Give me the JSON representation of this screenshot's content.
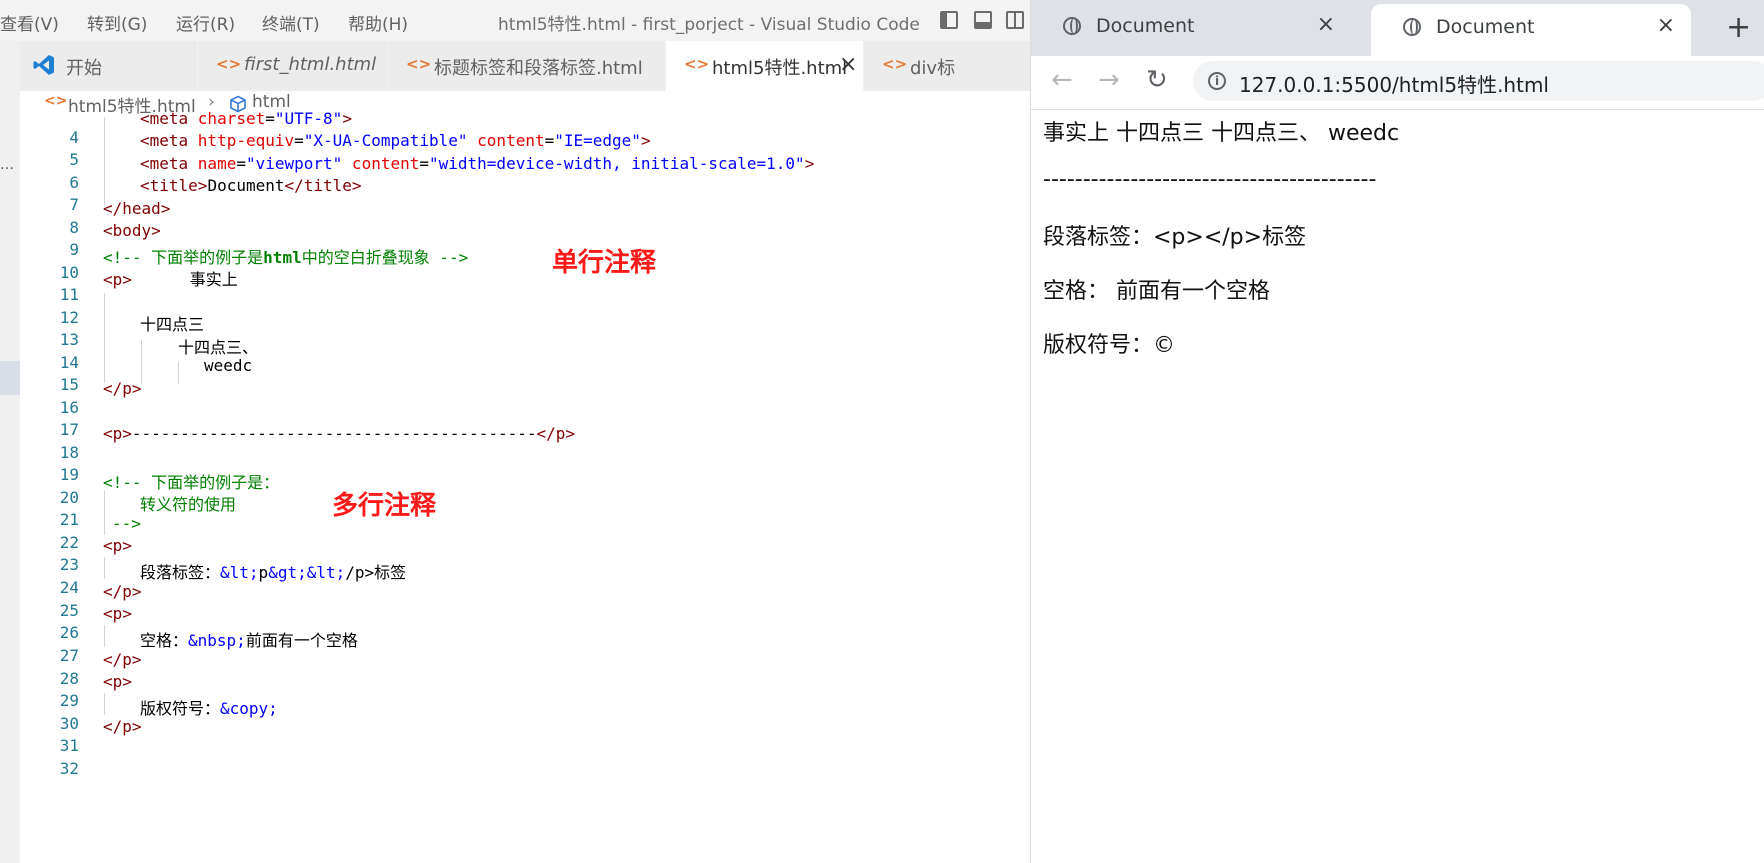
{
  "vscode": {
    "menu": [
      "查看(V)",
      "转到(G)",
      "运行(R)",
      "终端(T)",
      "帮助(H)"
    ],
    "window_title": "html5特性.html - first_porject - Visual Studio Code",
    "tabs": [
      {
        "label": "开始",
        "icon": "vscode-logo-icon"
      },
      {
        "label": "first_html.html",
        "icon": "html-file-icon"
      },
      {
        "label": "标题标签和段落标签.html",
        "icon": "html-file-icon"
      },
      {
        "label": "html5特性.html",
        "icon": "html-file-icon",
        "active": true,
        "close": "×"
      },
      {
        "label": "div标",
        "icon": "html-file-icon"
      }
    ],
    "breadcrumb": {
      "file": "html5特性.html",
      "separator": "›",
      "symbol": "html"
    },
    "activity_dots": "…",
    "line_numbers": [
      "4",
      "5",
      "6",
      "7",
      "8",
      "9",
      "10",
      "11",
      "12",
      "13",
      "14",
      "15",
      "16",
      "17",
      "18",
      "19",
      "20",
      "21",
      "22",
      "23",
      "24",
      "25",
      "26",
      "27",
      "28",
      "29",
      "30",
      "31",
      "32"
    ],
    "code": {
      "l4": {
        "open": "<meta ",
        "attr": "charset",
        "eq": "=",
        "val": "\"UTF-8\"",
        "close": ">"
      },
      "l5": {
        "open": "<meta ",
        "attr1": "http-equiv",
        "eq1": "=",
        "val1": "\"X-UA-Compatible\"",
        "attr2": " content",
        "eq2": "=",
        "val2": "\"IE=edge\"",
        "close": ">"
      },
      "l6": {
        "open": "<meta ",
        "attr1": "name",
        "eq1": "=",
        "val1": "\"viewport\"",
        "attr2": " content",
        "eq2": "=",
        "val2": "\"width=device-width, initial-scale=1.0\"",
        "close": ">"
      },
      "l7": {
        "open": "<title>",
        "text": "Document",
        "close": "</title>"
      },
      "l8": "</head>",
      "l9": "<body>",
      "l10": {
        "cmt1": "<!-- 下面举的例子是",
        "bold": "html",
        "cmt2": "中的空白折叠现象 -->"
      },
      "l11": {
        "tag": "<p>",
        "text": "      事实上"
      },
      "l13": "十四点三",
      "l14": "十四点三、",
      "l15": "weedc",
      "l16": "</p>",
      "l18": {
        "open": "<p>",
        "text": "------------------------------------------",
        "close": "</p>"
      },
      "l20": "<!-- 下面举的例子是：",
      "l21": "转义符的使用",
      "l22": "-->",
      "l23": "<p>",
      "l24": {
        "t1": "段落标签：",
        "e1": "&lt;",
        "t2": "p",
        "e2": "&gt;",
        "e3": "&lt;",
        "t3": "/p>标签"
      },
      "l25": "</p>",
      "l26": "<p>",
      "l27": {
        "t1": "空格：",
        "e1": "&nbsp;",
        "t2": "前面有一个空格"
      },
      "l28": "</p>",
      "l29": "<p>",
      "l30": {
        "t1": "版权符号：",
        "e1": "&copy;"
      },
      "l31": "</p>"
    },
    "annotations": {
      "single_line": "单行注释",
      "multi_line": "多行注释"
    },
    "colors": {
      "tag": "#800000",
      "attr": "#e50000",
      "string": "#0000ff",
      "comment": "#008000",
      "annotation": "#ff1a1a"
    }
  },
  "browser": {
    "tabs": [
      {
        "label": "Document",
        "close": "×"
      },
      {
        "label": "Document",
        "close": "×",
        "active": true
      }
    ],
    "new_tab": "+",
    "nav": {
      "back": "←",
      "forward": "→",
      "reload": "↻"
    },
    "info": "i",
    "url": "127.0.0.1:5500/html5特性.html",
    "page": {
      "p1": "事实上 十四点三 十四点三、 weedc",
      "p2": "------------------------------------------",
      "p3": "段落标签：<p></p>标签",
      "p4": "空格： 前面有一个空格",
      "p5": "版权符号：©"
    }
  }
}
